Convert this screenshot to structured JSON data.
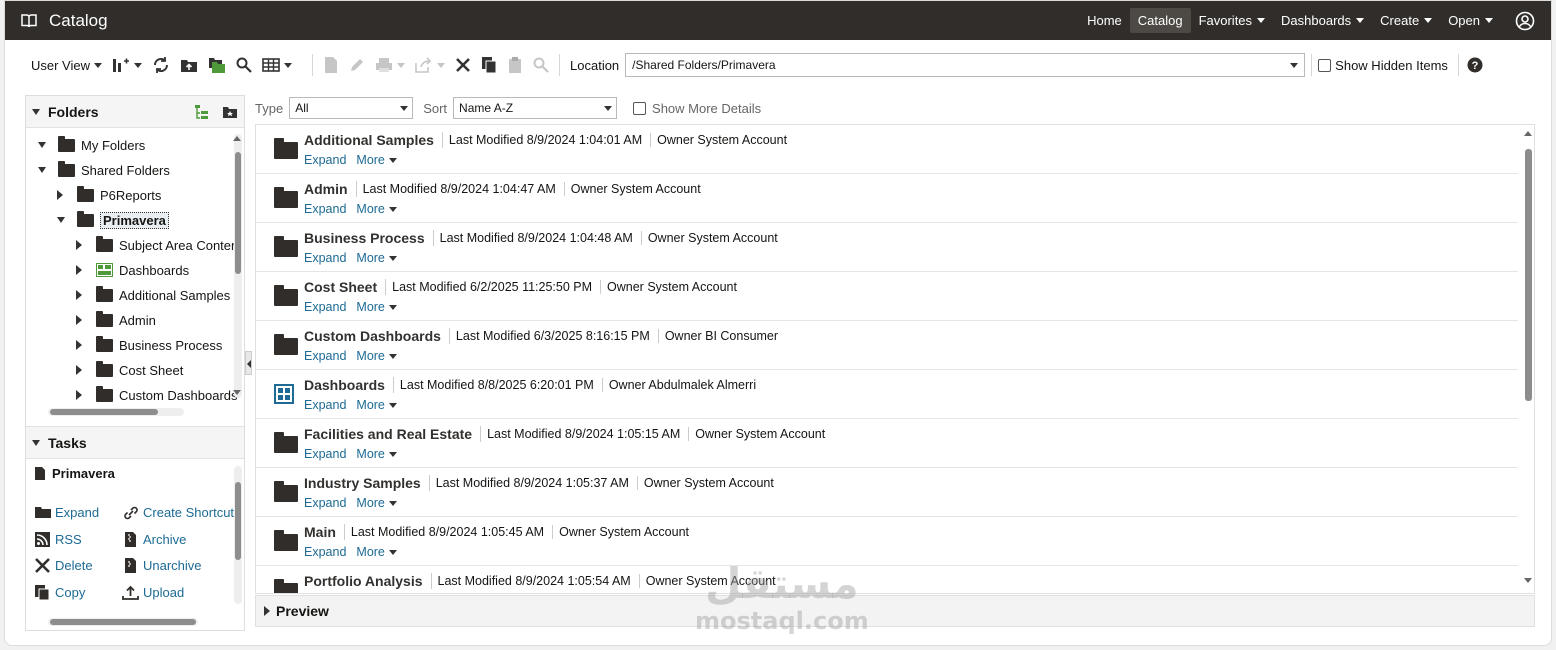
{
  "app": {
    "title": "Catalog",
    "nav": [
      {
        "label": "Home",
        "dropdown": false,
        "active": false
      },
      {
        "label": "Catalog",
        "dropdown": false,
        "active": true
      },
      {
        "label": "Favorites",
        "dropdown": true,
        "active": false
      },
      {
        "label": "Dashboards",
        "dropdown": true,
        "active": false
      },
      {
        "label": "Create",
        "dropdown": true,
        "active": false
      },
      {
        "label": "Open",
        "dropdown": true,
        "active": false
      }
    ]
  },
  "toolbar": {
    "view_label": "User View",
    "location_label": "Location",
    "location_value": "/Shared Folders/Primavera",
    "show_hidden_label": "Show Hidden Items"
  },
  "folders_panel": {
    "title": "Folders",
    "tree": [
      {
        "label": "My Folders",
        "depth": 0,
        "expanded": true,
        "icon": "folder"
      },
      {
        "label": "Shared Folders",
        "depth": 0,
        "expanded": true,
        "icon": "folder"
      },
      {
        "label": "P6Reports",
        "depth": 1,
        "expanded": false,
        "icon": "folder"
      },
      {
        "label": "Primavera",
        "depth": 1,
        "expanded": true,
        "icon": "folder",
        "selected": true
      },
      {
        "label": "Subject Area Conter",
        "depth": 2,
        "expanded": false,
        "icon": "folder"
      },
      {
        "label": "Dashboards",
        "depth": 2,
        "expanded": false,
        "icon": "dashboard"
      },
      {
        "label": "Additional Samples",
        "depth": 2,
        "expanded": false,
        "icon": "folder"
      },
      {
        "label": "Admin",
        "depth": 2,
        "expanded": false,
        "icon": "folder"
      },
      {
        "label": "Business Process",
        "depth": 2,
        "expanded": false,
        "icon": "folder"
      },
      {
        "label": "Cost Sheet",
        "depth": 2,
        "expanded": false,
        "icon": "folder"
      },
      {
        "label": "Custom Dashboards",
        "depth": 2,
        "expanded": false,
        "icon": "folder"
      }
    ]
  },
  "tasks_panel": {
    "title": "Tasks",
    "selected_item": "Primavera",
    "tasks": [
      {
        "label": "Expand",
        "icon": "folder-icon"
      },
      {
        "label": "Create Shortcut",
        "icon": "link-icon"
      },
      {
        "label": "RSS",
        "icon": "rss-icon"
      },
      {
        "label": "Archive",
        "icon": "archive-icon"
      },
      {
        "label": "Delete",
        "icon": "delete-icon"
      },
      {
        "label": "Unarchive",
        "icon": "unarchive-icon"
      },
      {
        "label": "Copy",
        "icon": "copy-icon"
      },
      {
        "label": "Upload",
        "icon": "upload-icon"
      }
    ]
  },
  "filters": {
    "type_label": "Type",
    "type_value": "All",
    "sort_label": "Sort",
    "sort_value": "Name A-Z",
    "details_label": "Show More Details"
  },
  "items": [
    {
      "name": "Additional Samples",
      "modified": "Last Modified 8/9/2024 1:04:01 AM",
      "owner": "Owner System Account",
      "icon": "folder"
    },
    {
      "name": "Admin",
      "modified": "Last Modified 8/9/2024 1:04:47 AM",
      "owner": "Owner System Account",
      "icon": "folder"
    },
    {
      "name": "Business Process",
      "modified": "Last Modified 8/9/2024 1:04:48 AM",
      "owner": "Owner System Account",
      "icon": "folder"
    },
    {
      "name": "Cost Sheet",
      "modified": "Last Modified 6/2/2025 11:25:50 PM",
      "owner": "Owner System Account",
      "icon": "folder"
    },
    {
      "name": "Custom Dashboards",
      "modified": "Last Modified 6/3/2025 8:16:15 PM",
      "owner": "Owner BI Consumer",
      "icon": "folder"
    },
    {
      "name": "Dashboards",
      "modified": "Last Modified 8/8/2025 6:20:01 PM",
      "owner": "Owner Abdulmalek Almerri",
      "icon": "dashboard"
    },
    {
      "name": "Facilities and Real Estate",
      "modified": "Last Modified 8/9/2024 1:05:15 AM",
      "owner": "Owner System Account",
      "icon": "folder"
    },
    {
      "name": "Industry Samples",
      "modified": "Last Modified 8/9/2024 1:05:37 AM",
      "owner": "Owner System Account",
      "icon": "folder"
    },
    {
      "name": "Main",
      "modified": "Last Modified 8/9/2024 1:05:45 AM",
      "owner": "Owner System Account",
      "icon": "folder"
    },
    {
      "name": "Portfolio Analysis",
      "modified": "Last Modified 8/9/2024 1:05:54 AM",
      "owner": "Owner System Account",
      "icon": "folder"
    }
  ],
  "row_actions": {
    "expand": "Expand",
    "more": "More"
  },
  "preview": {
    "label": "Preview"
  },
  "watermark": {
    "arabic": "مستقل",
    "latin": "mostaql.com"
  }
}
